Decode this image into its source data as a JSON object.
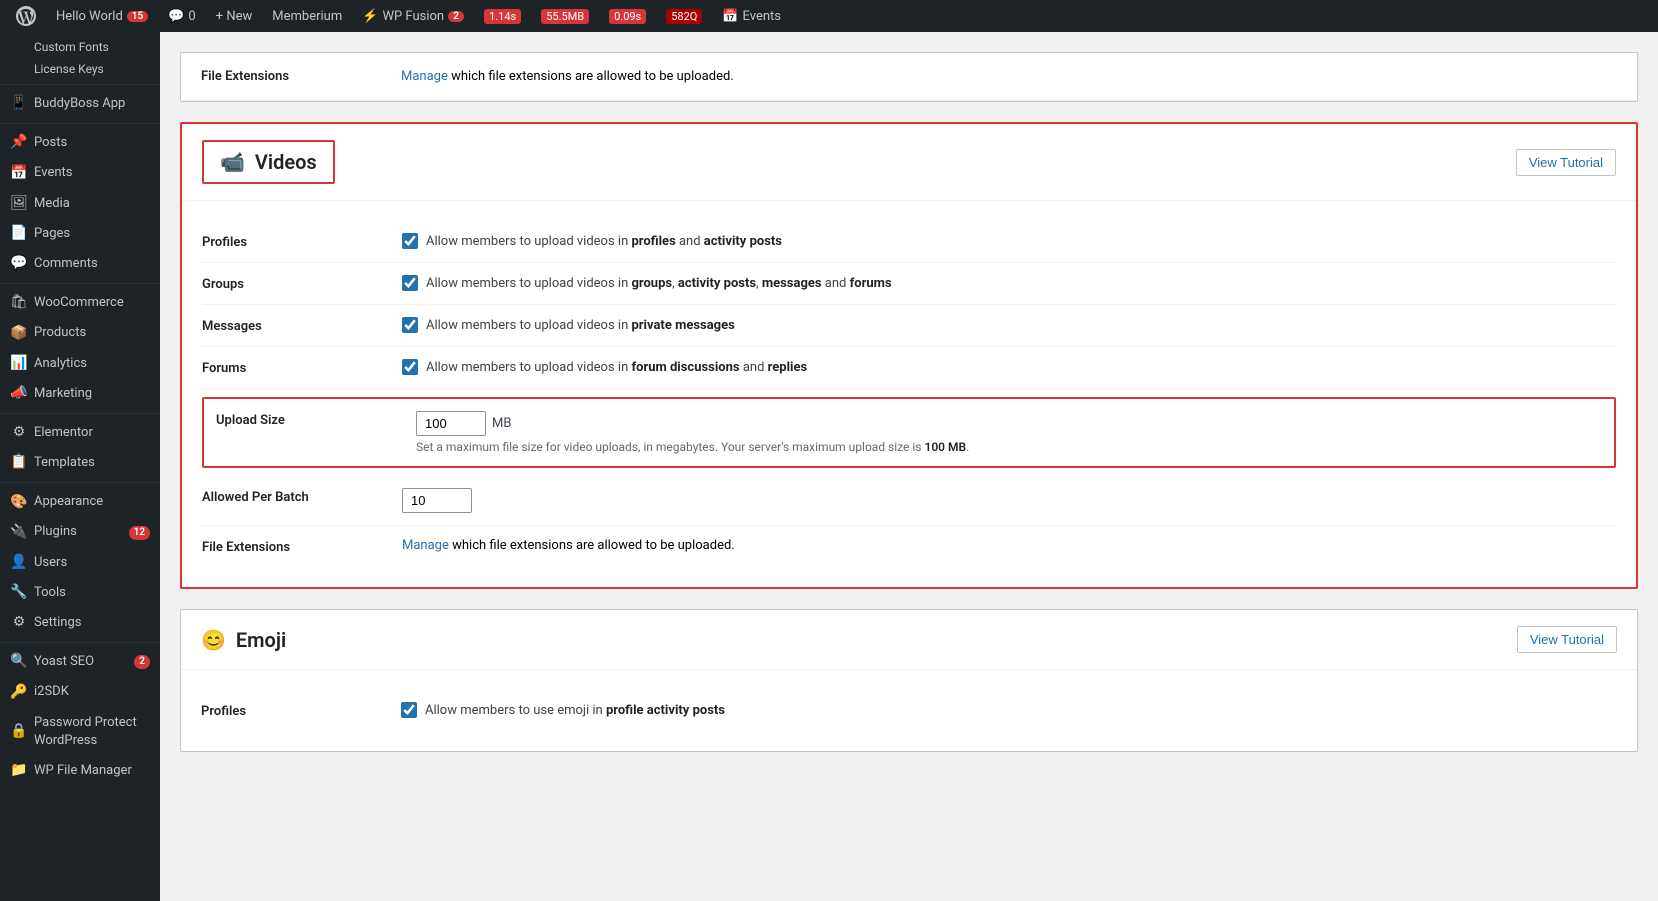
{
  "adminBar": {
    "wpLogoAlt": "WordPress",
    "siteName": "Hello World",
    "siteCount": "15",
    "comments": "0",
    "newLabel": "+ New",
    "memberium": "Memberium",
    "wpFusionLabel": "WP Fusion",
    "wpFusionBadge": "2",
    "perf1": "1.14s",
    "perf2": "55.5MB",
    "perf3": "0.09s",
    "perf4": "582Q",
    "events": "Events"
  },
  "sidebar": {
    "customFonts": "Custom Fonts",
    "licenseKeys": "License Keys",
    "buddybossApp": "BuddyBoss App",
    "posts": "Posts",
    "events": "Events",
    "media": "Media",
    "pages": "Pages",
    "comments": "Comments",
    "woocommerce": "WooCommerce",
    "products": "Products",
    "analytics": "Analytics",
    "marketing": "Marketing",
    "elementor": "Elementor",
    "templates": "Templates",
    "appearance": "Appearance",
    "plugins": "Plugins",
    "pluginsBadge": "12",
    "users": "Users",
    "tools": "Tools",
    "settings": "Settings",
    "yoastSeo": "Yoast SEO",
    "yoastBadge": "2",
    "i2sdk": "i2SDK",
    "passwordProtect": "Password Protect WordPress",
    "wpFileManager": "WP File Manager"
  },
  "topCard": {
    "label": "File Extensions",
    "manageText": "Manage",
    "manageAfter": "which file extensions are allowed to be uploaded."
  },
  "videosCard": {
    "title": "Videos",
    "icon": "📹",
    "viewTutorialLabel": "View Tutorial",
    "profilesLabel": "Profiles",
    "profilesCheck": true,
    "profilesText1": "Allow members to upload videos in ",
    "profilesBold1": "profiles",
    "profilesText2": " and ",
    "profilesBold2": "activity posts",
    "groupsLabel": "Groups",
    "groupsCheck": true,
    "groupsText1": "Allow members to upload videos in ",
    "groupsBold1": "groups",
    "groupsText2": ", ",
    "groupsBold2": "activity posts",
    "groupsText3": ", ",
    "groupsBold3": "messages",
    "groupsText4": " and ",
    "groupsBold4": "forums",
    "messagesLabel": "Messages",
    "messagesCheck": true,
    "messagesText1": "Allow members to upload videos in ",
    "messagesBold1": "private messages",
    "forumsLabel": "Forums",
    "forumsCheck": true,
    "forumsText1": "Allow members to upload videos in ",
    "forumsBold1": "forum discussions",
    "forumsText2": " and ",
    "forumsBold2": "replies",
    "uploadSizeLabel": "Upload Size",
    "uploadSizeValue": "100",
    "uploadSizeUnit": "MB",
    "uploadSizeDesc1": "Set a maximum file size for video uploads, in megabytes. Your server's maximum upload size is ",
    "uploadSizeDescBold": "100 MB",
    "uploadSizeDesc2": ".",
    "allowedPerBatchLabel": "Allowed Per Batch",
    "allowedPerBatchValue": "10",
    "fileExtLabel": "File Extensions",
    "fileExtManage": "Manage",
    "fileExtAfter": "which file extensions are allowed to be uploaded."
  },
  "emojiCard": {
    "title": "Emoji",
    "icon": "😊",
    "viewTutorialLabel": "View Tutorial",
    "profilesLabel": "Profiles",
    "profilesCheck": true,
    "profilesText1": "Allow members to use emoji in ",
    "profilesBold1": "profile activity posts"
  }
}
